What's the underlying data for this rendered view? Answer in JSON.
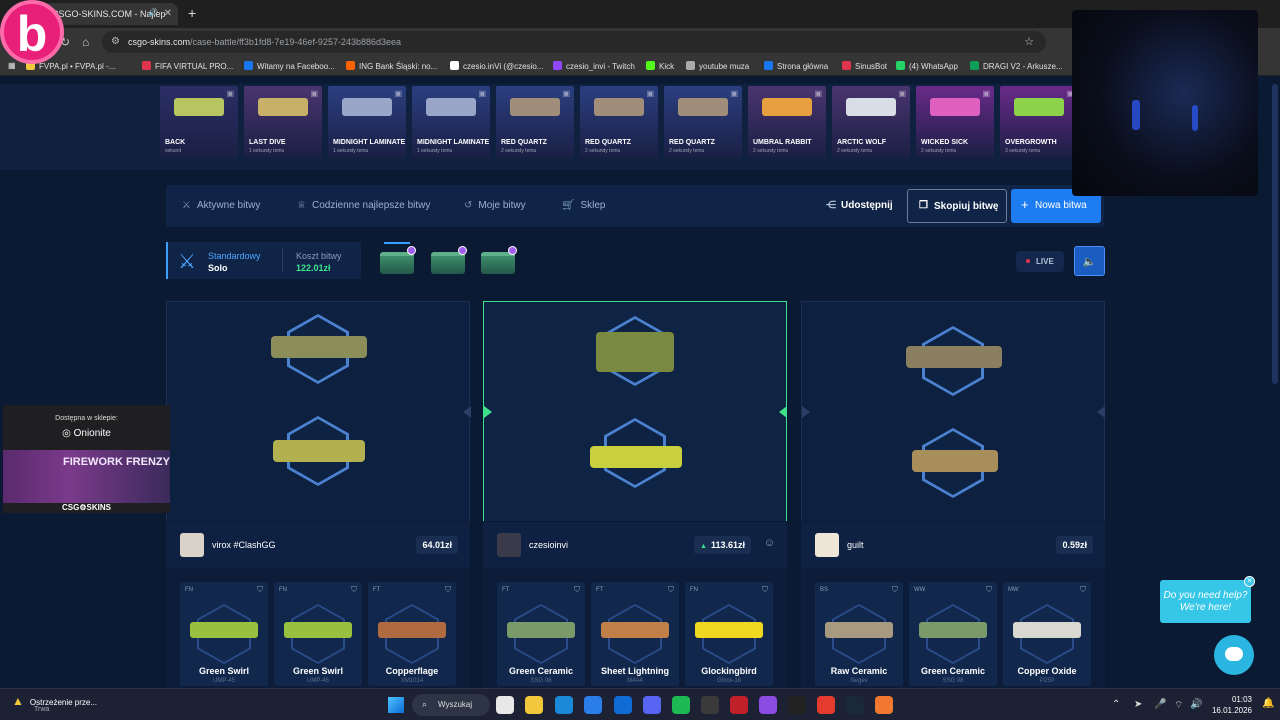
{
  "browser": {
    "tab_title": "CSGO-SKINS.COM - Najlep",
    "url_domain": "csgo-skins.com",
    "url_path": "/case-battle/ff3b1fd8-7e19-46ef-9257-243b886d3eea",
    "bookmarks": [
      {
        "label": "FVPA.pl • FVPA.pl -...",
        "color": "#f2c73c"
      },
      {
        "label": "FIFA VIRTUAL PRO...",
        "color": "#e0334c"
      },
      {
        "label": "Witamy na Faceboo...",
        "color": "#1877f2"
      },
      {
        "label": "ING Bank Śląski: no...",
        "color": "#ff6200"
      },
      {
        "label": "czesio.inVi (@czesio...",
        "color": "#ffffff"
      },
      {
        "label": "czesio_invi - Twitch",
        "color": "#9146ff"
      },
      {
        "label": "Kick",
        "color": "#53fc18"
      },
      {
        "label": "youtube muza",
        "color": "#aaaaaa"
      },
      {
        "label": "Strona główna",
        "color": "#1877f2"
      },
      {
        "label": "SinusBot",
        "color": "#e0334c"
      },
      {
        "label": "(4) WhatsApp",
        "color": "#25d366"
      },
      {
        "label": "DRAGI V2 - Arkusze...",
        "color": "#0f9d58"
      }
    ]
  },
  "brand_logo": "b",
  "case_strip": {
    "drops": [
      {
        "name": "BACK",
        "time": "sekund",
        "bg": "#2b2f66",
        "gun": "#b7c560"
      },
      {
        "name": "LAST DIVE",
        "time": "1 sekundy temu",
        "bg": "#4a3570",
        "gun": "#c8b068"
      },
      {
        "name": "MIDNIGHT LAMINATE",
        "time": "1 sekundy temu",
        "bg": "#2b3f80",
        "gun": "#9aa6c8"
      },
      {
        "name": "MIDNIGHT LAMINATE",
        "time": "1 sekundy temu",
        "bg": "#2b3f80",
        "gun": "#9aa6c8"
      },
      {
        "name": "RED QUARTZ",
        "time": "2 sekundy temu",
        "bg": "#2b3f80",
        "gun": "#a08e7a"
      },
      {
        "name": "RED QUARTZ",
        "time": "2 sekundy temu",
        "bg": "#2b3f80",
        "gun": "#a08e7a"
      },
      {
        "name": "RED QUARTZ",
        "time": "2 sekundy temu",
        "bg": "#2b3f80",
        "gun": "#a08e7a"
      },
      {
        "name": "UMBRAL RABBIT",
        "time": "2 sekundy temu",
        "bg": "#4a3570",
        "gun": "#e6a040"
      },
      {
        "name": "ARCTIC WOLF",
        "time": "2 sekundy temu",
        "bg": "#4a3570",
        "gun": "#d8dde6"
      },
      {
        "name": "WICKED SICK",
        "time": "2 sekundy temu",
        "bg": "#6a2a8a",
        "gun": "#e060c0"
      },
      {
        "name": "OVERGROWTH",
        "time": "3 sekundy temu",
        "bg": "#6a2a8a",
        "gun": "#8cd24a"
      }
    ]
  },
  "nav": {
    "items": [
      {
        "label": "Aktywne bitwy",
        "icon": "⚔"
      },
      {
        "label": "Codzienne najlepsze bitwy",
        "icon": "🏆"
      },
      {
        "label": "Moje bitwy",
        "icon": "↺"
      },
      {
        "label": "Sklep",
        "icon": "🛒"
      }
    ],
    "share": "Udostępnij",
    "copy": "Skopiuj bitwę",
    "new_battle": "Nowa bitwa"
  },
  "battle": {
    "mode": "Standardowy",
    "type": "Solo",
    "cost_label": "Koszt bitwy",
    "cost_value": "122.01zł",
    "live": "LIVE"
  },
  "arenas": [
    {
      "weapons": [
        {
          "color": "#8c8e5a"
        },
        {
          "color": "#b3b050"
        }
      ]
    },
    {
      "weapons": [
        {
          "color": "#7a8a40"
        },
        {
          "color": "#c8d040"
        }
      ]
    },
    {
      "weapons": [
        {
          "color": "#8a8060"
        },
        {
          "color": "#a88e5a"
        }
      ]
    }
  ],
  "players": [
    {
      "name": "virox #ClashGG",
      "value": "64.01zł",
      "avatar_color": "#d8d2c8",
      "items": [
        {
          "wear": "FN",
          "name": "Green Swirl",
          "type": "UMP-45",
          "color": "#9ac040"
        },
        {
          "wear": "FN",
          "name": "Green Swirl",
          "type": "UMP-45",
          "color": "#9ac040"
        },
        {
          "wear": "FT",
          "name": "Copperflage",
          "type": "XM1014",
          "color": "#b06a40"
        }
      ]
    },
    {
      "name": "czesioinvi",
      "value": "113.61zł",
      "avatar_color": "#3a3a4a",
      "items": [
        {
          "wear": "FT",
          "name": "Green Ceramic",
          "type": "SSG 08",
          "color": "#7a9a6a"
        },
        {
          "wear": "FT",
          "name": "Sheet Lightning",
          "type": "M4A4",
          "color": "#c08048"
        },
        {
          "wear": "FN",
          "name": "Glockingbird",
          "type": "Glock-18",
          "color": "#f0d820"
        }
      ]
    },
    {
      "name": "guilt",
      "value": "0.59zł",
      "avatar_color": "#f0e6d8",
      "items": [
        {
          "wear": "BS",
          "name": "Raw Ceramic",
          "type": "Negev",
          "color": "#a89a80"
        },
        {
          "wear": "WW",
          "name": "Green Ceramic",
          "type": "SSG 08",
          "color": "#7a9a6a"
        },
        {
          "wear": "MW",
          "name": "Copper Oxide",
          "type": "P250",
          "color": "#d8d8d0"
        }
      ]
    }
  ],
  "promo": {
    "line1": "Dostępna w sklepie:",
    "line2": "Onionite",
    "art": "FIREWORK FRENZY",
    "brand": "CSG⚙SKINS"
  },
  "help": {
    "text": "Do you need help? We're here!"
  },
  "taskbar": {
    "warning_title": "Ostrzeżenie prze...",
    "warning_sub": "Trwa",
    "search": "Wyszukaj",
    "time": "01:03",
    "date": "16.01.2026"
  }
}
